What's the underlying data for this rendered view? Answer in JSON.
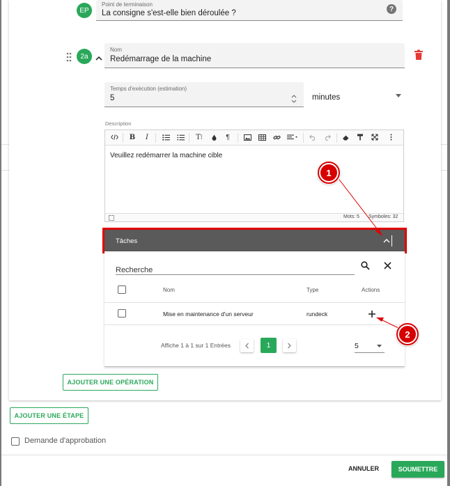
{
  "endpoint": {
    "avatar": "EP",
    "label": "Point de terminaison",
    "value": "La consigne s'est-elle bien déroulée ?",
    "help_icon": "help-circle-icon"
  },
  "operation": {
    "avatar": "2a",
    "name_label": "Nom",
    "name_value": "Redémarrage de la machine",
    "exec_time_label": "Temps d'exécution (estimation)",
    "exec_time_value": "5",
    "unit_value": "minutes",
    "description_label": "Description",
    "description_text": "Veuillez redémarrer la machine cible",
    "word_count": "Mots: 5",
    "symbol_count": "Symboles: 32",
    "toolbar": [
      "code-view",
      "bold",
      "italic",
      "bullet-list",
      "numbered-list",
      "font-size",
      "color",
      "paragraph",
      "image",
      "table",
      "link",
      "align",
      "undo",
      "redo",
      "eraser",
      "format-painter",
      "fullscreen",
      "more"
    ],
    "toolbar_glyphs": {
      "bold": "B",
      "italic": "I",
      "font_size": "T⁝",
      "paragraph": "¶"
    }
  },
  "tasks": {
    "header": "Tâches",
    "search_placeholder": "Recherche",
    "col_name": "Nom",
    "col_type": "Type",
    "col_actions": "Actions",
    "rows": [
      {
        "name": "Mise en maintenance d'un serveur",
        "type": "rundeck"
      }
    ],
    "pagination_text": "Affiche 1 à 1 sur 1 Entrées",
    "current_page": "1",
    "page_size": "5"
  },
  "buttons": {
    "add_operation": "AJOUTER UNE OPÉRATION",
    "add_step": "AJOUTER UNE ÉTAPE",
    "cancel": "ANNULER",
    "submit": "SOUMETTRE"
  },
  "approval_label": "Demande d'approbation",
  "callouts": {
    "one": "1",
    "two": "2"
  },
  "colors": {
    "accent": "#2aa85a",
    "danger": "#e53935",
    "callout": "#d60000",
    "tasks_header": "#5a5a5a"
  }
}
